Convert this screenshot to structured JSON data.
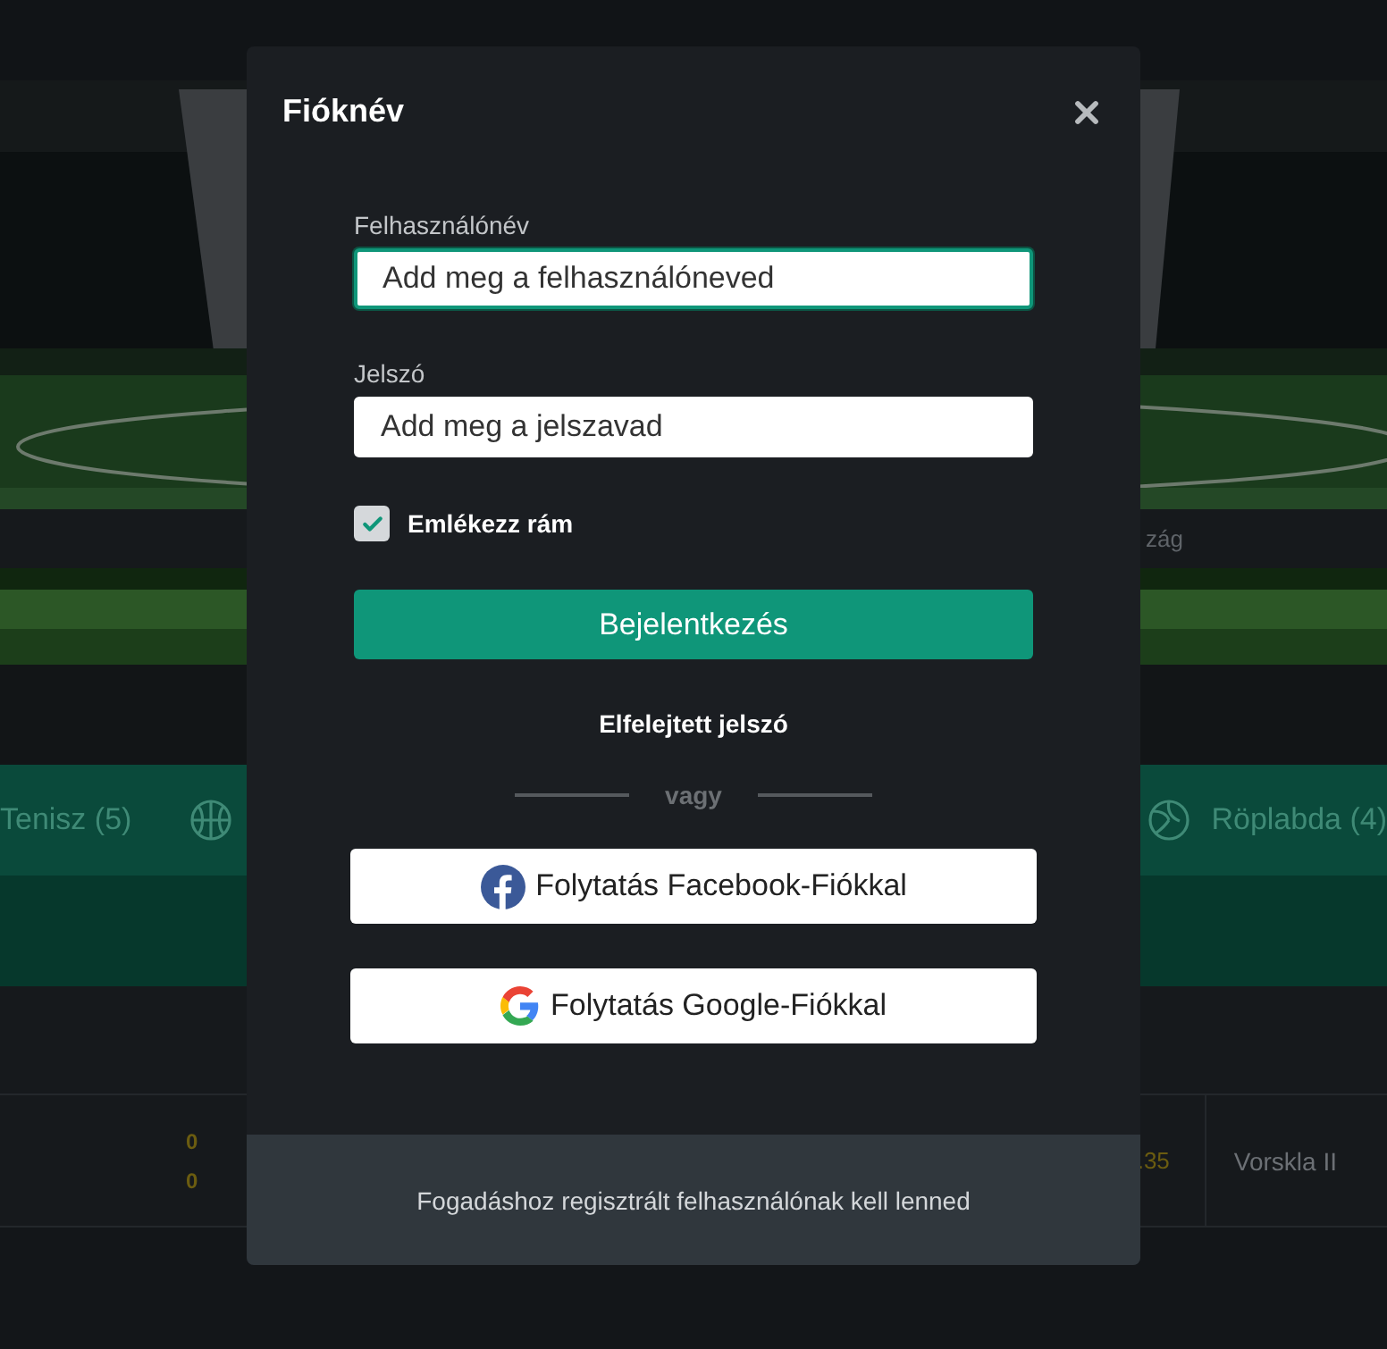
{
  "background": {
    "banner_caption": "zág",
    "sport_tabs": [
      "Tenisz (5)",
      "Röplabda (4)"
    ],
    "match_row": {
      "scores": [
        "0",
        "0"
      ],
      "odds": ".35",
      "team": "Vorskla II"
    }
  },
  "modal": {
    "title": "Fióknév",
    "fields": [
      {
        "label": "Felhasználónév",
        "placeholder": "Add meg a felhasználóneved",
        "focused": true
      },
      {
        "label": "Jelszó",
        "placeholder": "Add meg a jelszavad",
        "focused": false
      }
    ],
    "remember": {
      "label": "Emlékezz rám",
      "checked": true
    },
    "login_button": "Bejelentkezés",
    "forgot_link": "Elfelejtett jelszó",
    "divider": "vagy",
    "social_buttons": [
      {
        "kind": "facebook",
        "label": "Folytatás Facebook-Fiókkal"
      },
      {
        "kind": "google",
        "label": "Folytatás Google-Fiókkal"
      }
    ],
    "footer": "Fogadáshoz regisztrált felhasználónak kell lenned"
  }
}
